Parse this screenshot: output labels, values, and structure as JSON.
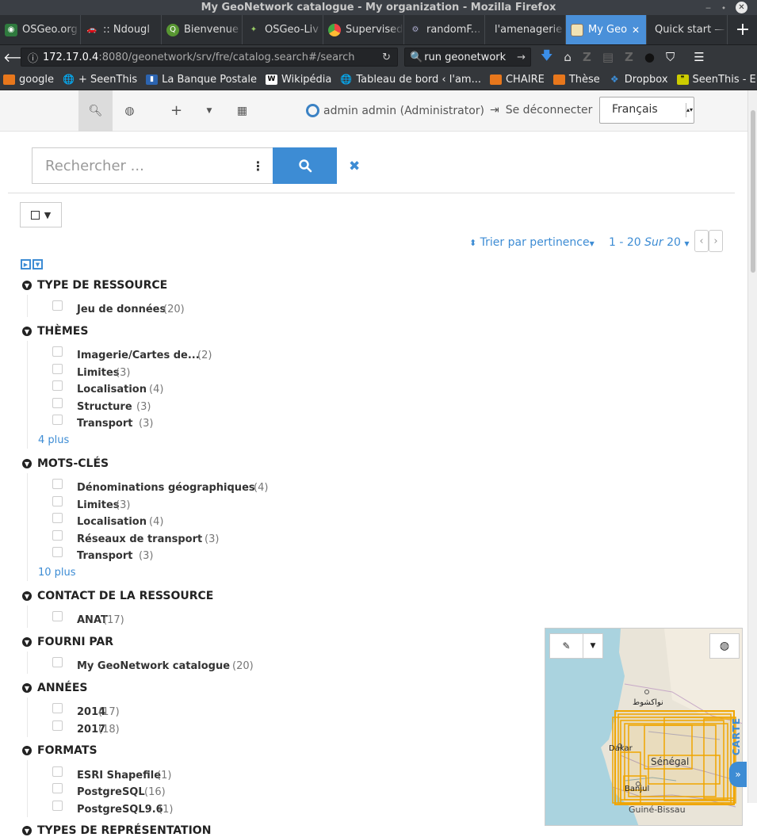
{
  "window": {
    "title": "My GeoNetwork catalogue - My organization - Mozilla Firefox",
    "minimize": "‒",
    "restore": "⬩",
    "close": "✕"
  },
  "tabs": [
    {
      "label": "OSGeo.org",
      "icon": "osgeo-icon"
    },
    {
      "label": ":: Ndougl",
      "icon": "car-icon"
    },
    {
      "label": "Bienvenue",
      "icon": "qgis-icon"
    },
    {
      "label": "OSGeo-Liv",
      "icon": "osgeo-live-icon"
    },
    {
      "label": "Supervised",
      "icon": "chrome-icon"
    },
    {
      "label": "randomF...",
      "icon": "gear-icon"
    },
    {
      "label": "l'amenagerie |",
      "icon": ""
    },
    {
      "label": "My Geo",
      "icon": "map-icon",
      "active": true
    },
    {
      "label": "Quick start —",
      "icon": ""
    }
  ],
  "nav": {
    "url_host": "172.17.0.4",
    "url_rest": ":8080/geonetwork/srv/fre/catalog.search#/search",
    "search_text": "run geonetwork"
  },
  "bookmarks": [
    {
      "label": "google",
      "icon": "folder-icon"
    },
    {
      "label": "+ SeenThis",
      "icon": "globe-icon"
    },
    {
      "label": "La Banque Postale",
      "icon": "bank-icon"
    },
    {
      "label": "Wikipédia",
      "icon": "wikipedia-icon"
    },
    {
      "label": "Tableau de bord ‹ l'am...",
      "icon": "globe-icon"
    },
    {
      "label": "CHAIRE",
      "icon": "folder-icon"
    },
    {
      "label": "Thèse",
      "icon": "folder-icon"
    },
    {
      "label": "Dropbox",
      "icon": "dropbox-icon"
    },
    {
      "label": "SeenThis - ElCep",
      "icon": "seenthis-icon"
    }
  ],
  "bookmarks_more": "»",
  "appbar": {
    "user": "admin admin (Administrator)",
    "logout": "Se déconnecter",
    "language": "Français"
  },
  "search": {
    "placeholder": "Rechercher ...",
    "options": "⋮",
    "sort_label": "Trier par pertinence",
    "paging_range": "1 - 20",
    "paging_of": "Sur",
    "paging_total": "20"
  },
  "facets": [
    {
      "title": "TYPE DE RESSOURCE",
      "items": [
        {
          "label": "Jeu de données",
          "count": "(20)"
        }
      ]
    },
    {
      "title": "THÈMES",
      "items": [
        {
          "label": "Imagerie/Cartes de...",
          "count": "(2)"
        },
        {
          "label": "Limites",
          "count": "(3)"
        },
        {
          "label": "Localisation",
          "count": "(4)"
        },
        {
          "label": "Structure",
          "count": "(3)"
        },
        {
          "label": "Transport",
          "count": "(3)"
        }
      ],
      "more": "4  plus"
    },
    {
      "title": "MOTS-CLÉS",
      "items": [
        {
          "label": "Dénominations géographiques",
          "count": "(4)"
        },
        {
          "label": "Limites",
          "count": "(3)"
        },
        {
          "label": "Localisation",
          "count": "(4)"
        },
        {
          "label": "Réseaux de transport",
          "count": "(3)"
        },
        {
          "label": "Transport",
          "count": "(3)"
        }
      ],
      "more": "10  plus"
    },
    {
      "title": "CONTACT DE LA RESSOURCE",
      "items": [
        {
          "label": "ANAT",
          "count": "(17)"
        }
      ]
    },
    {
      "title": "FOURNI PAR",
      "items": [
        {
          "label": "My GeoNetwork catalogue",
          "count": "(20)"
        }
      ]
    },
    {
      "title": "ANNÉES",
      "items": [
        {
          "label": "2014",
          "count": "(17)"
        },
        {
          "label": "2017",
          "count": "(18)"
        }
      ]
    },
    {
      "title": "FORMATS",
      "items": [
        {
          "label": "ESRI Shapefile",
          "count": "(1)"
        },
        {
          "label": "PostgreSQL",
          "count": "(16)"
        },
        {
          "label": "PostgreSQL9.6",
          "count": "(1)"
        }
      ]
    },
    {
      "title": "TYPES DE REPRÉSENTATION",
      "items": []
    }
  ],
  "map": {
    "labels": {
      "nouakchott": "نواكشوط",
      "dakar": "Dakar",
      "senegal": "Sénégal",
      "banjul": "Banjul",
      "guinea_bissau": "Guiné-Bissau"
    },
    "carte_label": "CARTE"
  }
}
